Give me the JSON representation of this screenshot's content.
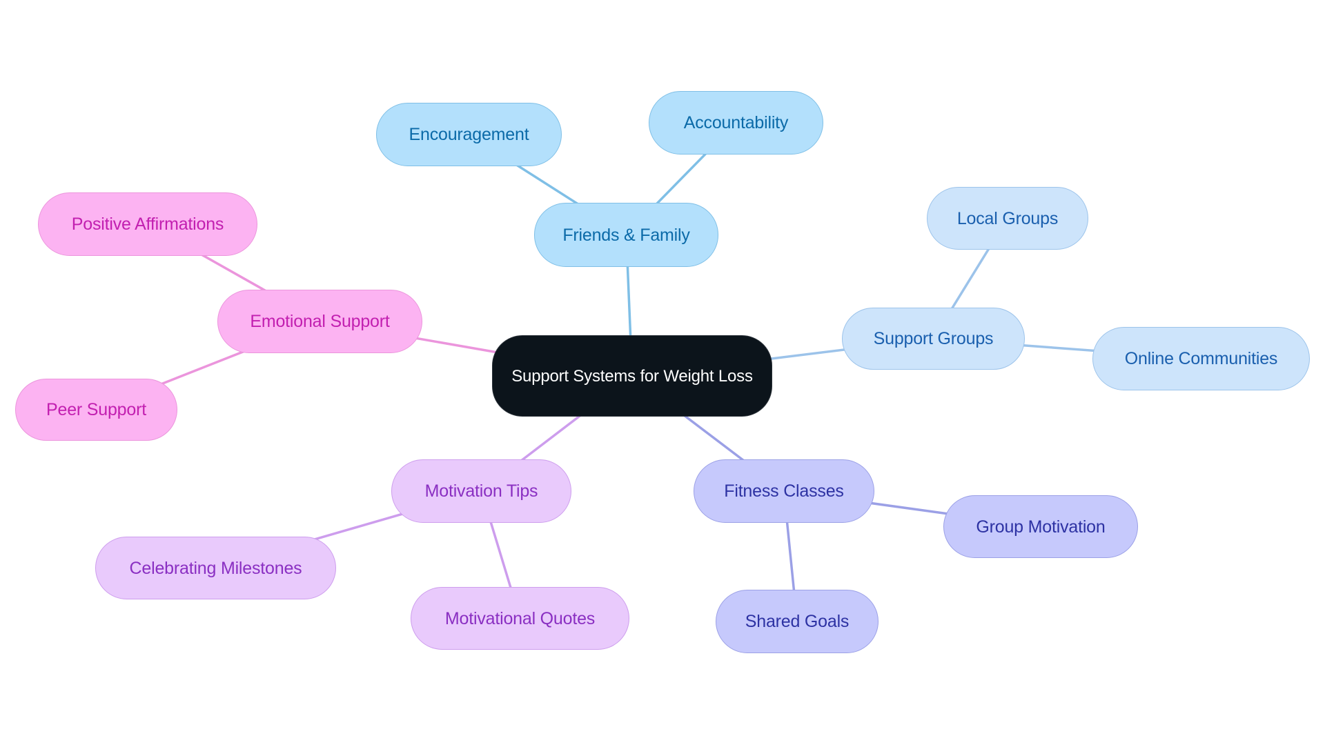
{
  "diagram": {
    "type": "mindmap",
    "root": {
      "id": "root",
      "label": "Support Systems for Weight Loss",
      "fill": "#0c141b",
      "stroke": "#2a3138",
      "text": "#ffffff"
    },
    "branches": [
      {
        "id": "friends",
        "label": "Friends & Family",
        "fill": "#b3e0fc",
        "stroke": "#7fbfe6",
        "text": "#0b6aa8",
        "line": "#7fbfe6",
        "children": [
          {
            "id": "encouragement",
            "label": "Encouragement"
          },
          {
            "id": "accountability",
            "label": "Accountability"
          }
        ]
      },
      {
        "id": "groups",
        "label": "Support Groups",
        "fill": "#cde4fb",
        "stroke": "#9cc3ea",
        "text": "#1a5fae",
        "line": "#9cc3ea",
        "children": [
          {
            "id": "local",
            "label": "Local Groups"
          },
          {
            "id": "online",
            "label": "Online Communities"
          }
        ]
      },
      {
        "id": "fitness",
        "label": "Fitness Classes",
        "fill": "#c6c9fc",
        "stroke": "#9ba0e6",
        "text": "#2d32a3",
        "line": "#9ba0e6",
        "children": [
          {
            "id": "groupmot",
            "label": "Group Motivation"
          },
          {
            "id": "shared",
            "label": "Shared Goals"
          }
        ]
      },
      {
        "id": "motivation",
        "label": "Motivation Tips",
        "fill": "#e9cafc",
        "stroke": "#cd9ded",
        "text": "#8a2fc2",
        "line": "#cd9ded",
        "children": [
          {
            "id": "celebrating",
            "label": "Celebrating Milestones"
          },
          {
            "id": "quotes",
            "label": "Motivational Quotes"
          }
        ]
      },
      {
        "id": "emotional",
        "label": "Emotional Support",
        "fill": "#fcb3f2",
        "stroke": "#eb95dc",
        "text": "#c21fb0",
        "line": "#eb95dc",
        "children": [
          {
            "id": "affirm",
            "label": "Positive Affirmations"
          },
          {
            "id": "peer",
            "label": "Peer Support"
          }
        ]
      }
    ]
  }
}
